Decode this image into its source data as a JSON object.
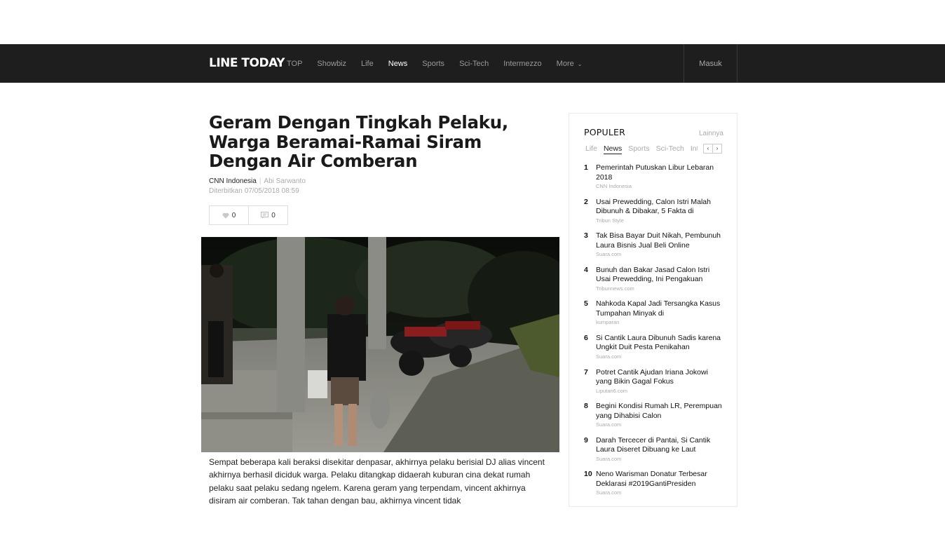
{
  "header": {
    "logo": "LINE TODAY",
    "nav": [
      {
        "label": "TOP",
        "active": false
      },
      {
        "label": "Showbiz",
        "active": false
      },
      {
        "label": "Life",
        "active": false
      },
      {
        "label": "News",
        "active": true
      },
      {
        "label": "Sports",
        "active": false
      },
      {
        "label": "Sci-Tech",
        "active": false
      },
      {
        "label": "Intermezzo",
        "active": false
      }
    ],
    "more_label": "More",
    "login_label": "Masuk"
  },
  "article": {
    "title": "Geram Dengan Tingkah Pelaku, Warga Beramai-Ramai Siram Dengan Air Comberan",
    "source": "CNN Indonesia",
    "separator": "|",
    "author": "Abi Sarwanto",
    "published_label": "Diterbitkan",
    "published_date": "07/05/2018 08:59",
    "likes": "0",
    "comments": "0",
    "body": "Sempat beberapa kali beraksi disekitar denpasar, akhirnya pelaku berisial DJ alias vincent akhirnya berhasil diciduk warga. Pelaku ditangkap didaerah kuburan cina dekat rumah pelaku saat pelaku sedang ngelem. Karena geram yang terpendam, vincent akhirnya disiram air comberan. Tak tahan dengan bau, akhirnya vincent tidak"
  },
  "sidebar": {
    "title": "POPULER",
    "more_label": "Lainnya",
    "tabs": [
      {
        "label": "Life",
        "active": false
      },
      {
        "label": "News",
        "active": true
      },
      {
        "label": "Sports",
        "active": false
      },
      {
        "label": "Sci-Tech",
        "active": false
      },
      {
        "label": "Intermezzo",
        "active": false
      }
    ],
    "prev_arrow": "‹",
    "next_arrow": "›",
    "items": [
      {
        "rank": "1",
        "headline": "Pemerintah Putuskan Libur Lebaran 2018",
        "source": "CNN Indonesia"
      },
      {
        "rank": "2",
        "headline": "Usai Prewedding, Calon Istri Malah Dibunuh & Dibakar, 5 Fakta di",
        "source": "Tribun Style"
      },
      {
        "rank": "3",
        "headline": "Tak Bisa Bayar Duit Nikah, Pembunuh Laura Bisnis Jual Beli Online",
        "source": "Suara.com"
      },
      {
        "rank": "4",
        "headline": "Bunuh dan Bakar Jasad Calon Istri Usai Prewedding, Ini Pengakuan",
        "source": "Tribunnews.com"
      },
      {
        "rank": "5",
        "headline": "Nahkoda Kapal Jadi Tersangka Kasus Tumpahan Minyak di",
        "source": "kumparan"
      },
      {
        "rank": "6",
        "headline": "Si Cantik Laura Dibunuh Sadis karena Ungkit Duit Pesta Penikahan",
        "source": "Suara.com"
      },
      {
        "rank": "7",
        "headline": "Potret Cantik Ajudan Iriana Jokowi yang Bikin Gagal Fokus",
        "source": "Liputan6.com"
      },
      {
        "rank": "8",
        "headline": "Begini Kondisi Rumah LR, Perempuan yang Dihabisi Calon",
        "source": "Suara.com"
      },
      {
        "rank": "9",
        "headline": "Darah Tercecer di Pantai, Si Cantik Laura Diseret Dibuang ke Laut",
        "source": "Suara.com"
      },
      {
        "rank": "10",
        "headline": "Neno Warisman Donatur Terbesar Deklarasi #2019GantiPresiden",
        "source": "Suara.com"
      }
    ]
  }
}
